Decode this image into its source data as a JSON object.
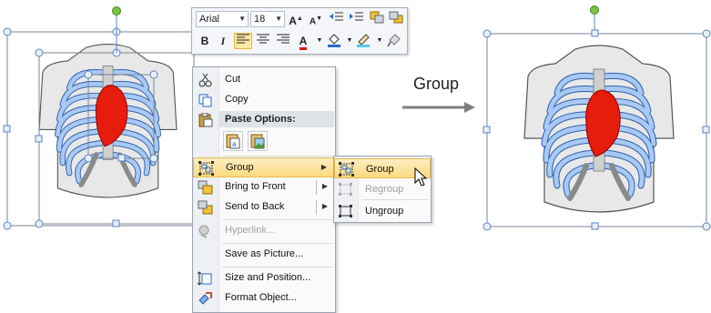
{
  "mini_toolbar": {
    "font_name": "Arial",
    "font_size": "18",
    "buttons": [
      "grow-font",
      "shrink-font",
      "decrease-list-level",
      "increase-list-level",
      "bring-forward",
      "send-backward",
      "bold",
      "italic",
      "align-left",
      "center",
      "align-right",
      "font-color",
      "shape-fill",
      "shape-outline",
      "format-painter"
    ]
  },
  "context_menu": {
    "cut": "Cut",
    "copy": "Copy",
    "paste_options": "Paste Options:",
    "group": "Group",
    "bring_to_front": "Bring to Front",
    "send_to_back": "Send to Back",
    "hyperlink": "Hyperlink...",
    "save_as_picture": "Save as Picture...",
    "size_and_position": "Size and Position...",
    "format_object": "Format Object..."
  },
  "submenu": {
    "group": "Group",
    "regroup": "Regroup",
    "ungroup": "Ungroup"
  },
  "arrow_label": "Group",
  "colors": {
    "menu_highlight": "#fcd97e",
    "selection_handle": "#5b84c4",
    "rotate_handle": "#7ec242",
    "rib_blue": "#8db4ea",
    "heart_red": "#e61c0c",
    "spine_gray": "#888888"
  }
}
